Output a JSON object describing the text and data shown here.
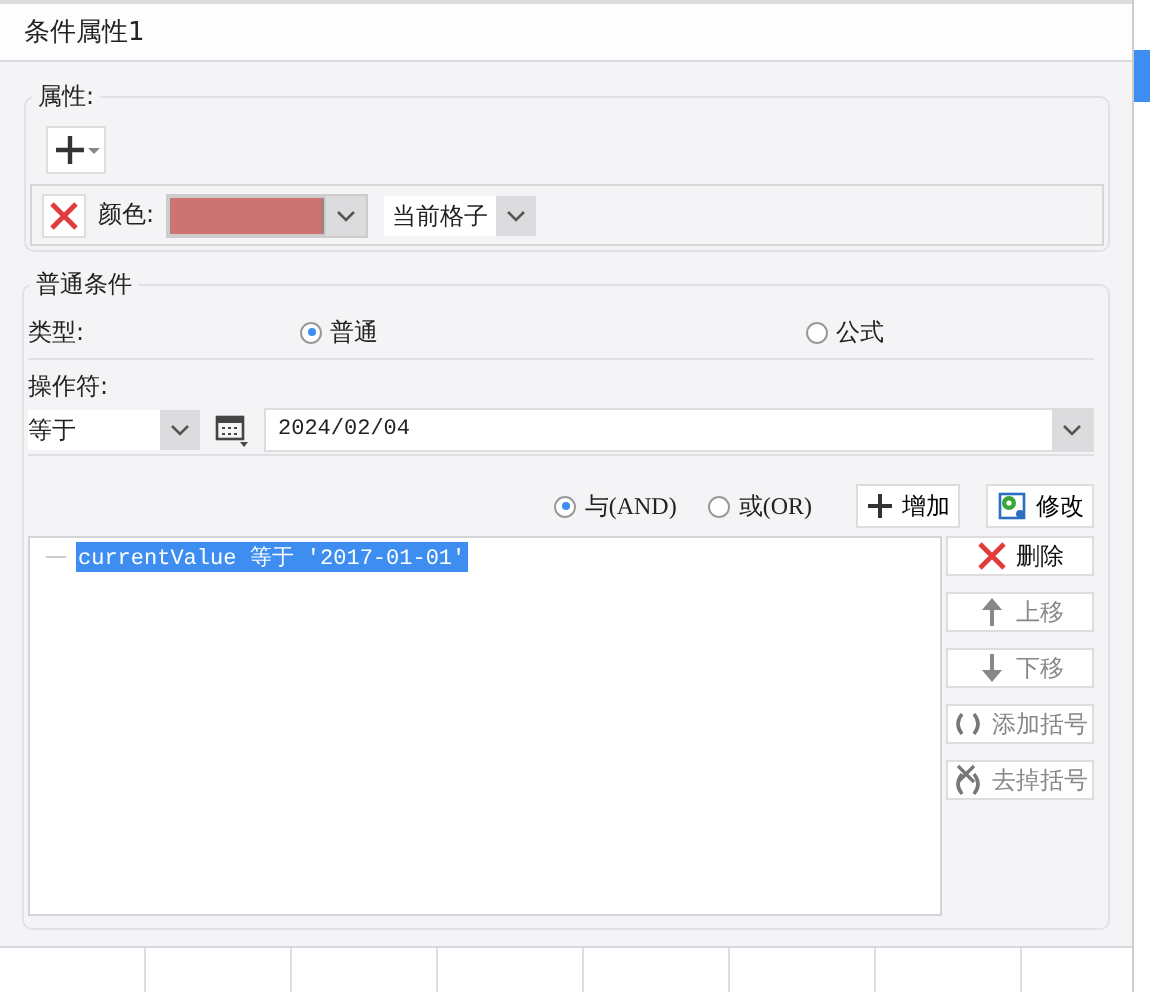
{
  "window": {
    "title": "条件属性1"
  },
  "properties": {
    "label": "属性:",
    "items": [
      {
        "kind": "color",
        "label": "颜色:",
        "color": "#cc7472",
        "scope": "当前格子"
      }
    ]
  },
  "condition": {
    "label": "普通条件",
    "type_label": "类型:",
    "types": [
      {
        "label": "普通",
        "selected": true
      },
      {
        "label": "公式",
        "selected": false
      }
    ],
    "operator_label": "操作符:",
    "operator": "等于",
    "value": "2024/02/04",
    "joins": [
      {
        "label": "与(AND)",
        "selected": true
      },
      {
        "label": "或(OR)",
        "selected": false
      }
    ],
    "add": "增加",
    "modify": "修改",
    "list": [
      {
        "text": "currentValue 等于 '2017-01-01'",
        "selected": true
      }
    ],
    "actions": [
      {
        "kind": "delete",
        "label": "删除",
        "disabled": false
      },
      {
        "kind": "up",
        "label": "上移",
        "disabled": true
      },
      {
        "kind": "down",
        "label": "下移",
        "disabled": true
      },
      {
        "kind": "add-bracket",
        "label": "添加括号",
        "disabled": true
      },
      {
        "kind": "remove-bracket",
        "label": "去掉括号",
        "disabled": true
      }
    ]
  }
}
